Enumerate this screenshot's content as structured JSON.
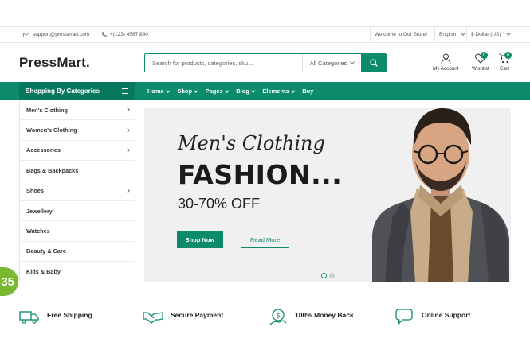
{
  "topbar": {
    "email": "support@pressmart.com",
    "phone": "+(123) 4567 890",
    "welcome": "Welcome to Our Store!",
    "language": "English",
    "currency": "$ Dollar (US)"
  },
  "header": {
    "logo": "PressMart.",
    "search_placeholder": "Search for products, categories, sku...",
    "category_select": "All Categories",
    "account_label": "My Account",
    "wishlist_label": "Wishlist",
    "wishlist_count": "0",
    "cart_label": "Cart",
    "cart_count": "0"
  },
  "nav": {
    "categories_label": "Shopping By Categories",
    "menu": [
      {
        "label": "Home"
      },
      {
        "label": "Shop"
      },
      {
        "label": "Pages"
      },
      {
        "label": "Blog"
      },
      {
        "label": "Elements"
      },
      {
        "label": "Buy"
      }
    ]
  },
  "sidebar": {
    "items": [
      {
        "label": "Men's Clothing"
      },
      {
        "label": "Women's Clothing"
      },
      {
        "label": "Accessories"
      },
      {
        "label": "Bags & Backpacks"
      },
      {
        "label": "Shoes"
      },
      {
        "label": "Jewellery"
      },
      {
        "label": "Watches"
      },
      {
        "label": "Beauty & Care"
      },
      {
        "label": "Kids & Baby"
      }
    ]
  },
  "hero": {
    "script_title": "Men's Clothing",
    "title": "FASHION...",
    "discount": "30-70% OFF",
    "shop_now": "Shop Now",
    "read_more": "Read More"
  },
  "counter": "35",
  "features": [
    {
      "title": "Free Shipping"
    },
    {
      "title": "Secure Payment"
    },
    {
      "title": "100% Money Back"
    },
    {
      "title": "Online Support"
    }
  ],
  "colors": {
    "accent": "#0b8a6c",
    "accent_dark": "#07775d",
    "counter_green": "#7ab82f"
  }
}
